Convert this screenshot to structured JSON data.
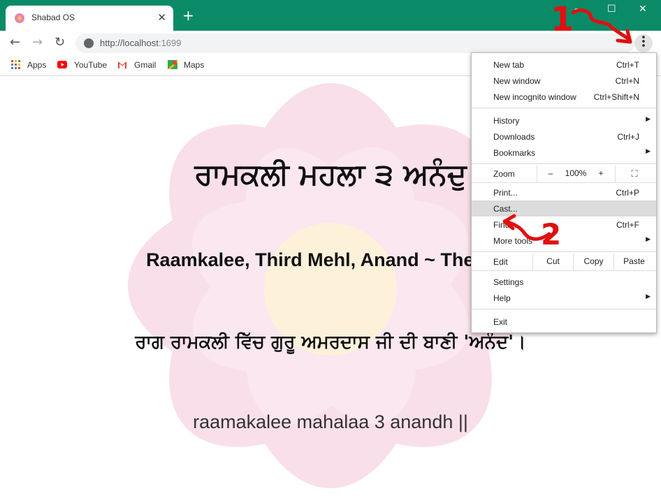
{
  "tab": {
    "title": "Shabad OS",
    "close": "✕"
  },
  "newtab_symbol": "+",
  "window_controls": {
    "minimize": "—",
    "maximize": "☐",
    "close": "✕"
  },
  "nav": {
    "back": "←",
    "forward": "→",
    "reload": "↻"
  },
  "omnibox": {
    "host": "http://localhost",
    "port": ":1699"
  },
  "bookmarks": [
    {
      "label": "Apps",
      "icon": "apps-grid-icon"
    },
    {
      "label": "YouTube",
      "icon": "youtube-icon"
    },
    {
      "label": "Gmail",
      "icon": "gmail-icon"
    },
    {
      "label": "Maps",
      "icon": "maps-icon"
    }
  ],
  "content": {
    "gurmukhi": "ਰਾਮਕਲੀ ਮਹਲਾ ੩ ਅਨੰਦੁ",
    "english": "Raamkalee, Third Mehl, Anand ~ The Son",
    "punjabi": "ਰਾਗ ਰਾਮਕਲੀ ਵਿੱਚ ਗੁਰੂ ਅਮਰਦਾਸ ਜੀ ਦੀ ਬਾਣੀ 'ਅਨੰਦ'।",
    "transliteration": "raamakalee mahalaa 3 anandh ||"
  },
  "menu": {
    "new_tab": {
      "label": "New tab",
      "shortcut": "Ctrl+T"
    },
    "new_window": {
      "label": "New window",
      "shortcut": "Ctrl+N"
    },
    "new_incognito": {
      "label": "New incognito window",
      "shortcut": "Ctrl+Shift+N"
    },
    "history": {
      "label": "History"
    },
    "downloads": {
      "label": "Downloads",
      "shortcut": "Ctrl+J"
    },
    "bookmarks": {
      "label": "Bookmarks"
    },
    "zoom": {
      "label": "Zoom",
      "minus": "–",
      "level": "100%",
      "plus": "+",
      "fullscreen": "⛶"
    },
    "print": {
      "label": "Print...",
      "shortcut": "Ctrl+P"
    },
    "cast": {
      "label": "Cast..."
    },
    "find": {
      "label": "Find...",
      "shortcut": "Ctrl+F"
    },
    "more_tools": {
      "label": "More tools"
    },
    "edit": {
      "label": "Edit",
      "cut": "Cut",
      "copy": "Copy",
      "paste": "Paste"
    },
    "settings": {
      "label": "Settings"
    },
    "help": {
      "label": "Help"
    },
    "exit": {
      "label": "Exit"
    }
  },
  "annotations": [
    "1",
    "2"
  ],
  "colors": {
    "titlebar": "#0b8a68",
    "highlight": "#dcdcdc",
    "annotation": "#e01010"
  }
}
